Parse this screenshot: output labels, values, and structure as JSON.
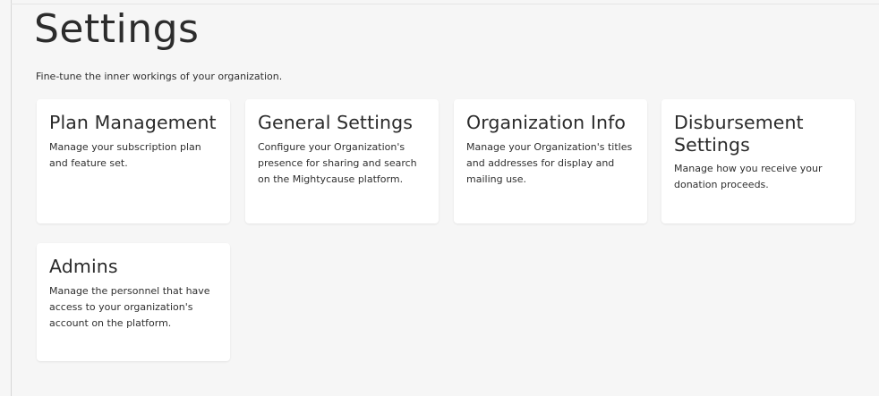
{
  "page": {
    "title": "Settings",
    "subtitle": "Fine-tune the inner workings of your organization."
  },
  "cards": [
    {
      "title": "Plan Management",
      "description": "Manage your subscription plan and feature set."
    },
    {
      "title": "General Settings",
      "description": "Configure your Organization's presence for sharing and search on the Mightycause platform."
    },
    {
      "title": "Organization Info",
      "description": "Manage your Organization's titles and addresses for display and mailing use."
    },
    {
      "title": "Disbursement Settings",
      "description": "Manage how you receive your donation proceeds."
    },
    {
      "title": "Admins",
      "description": "Manage the personnel that have access to your organization's account on the platform."
    }
  ]
}
